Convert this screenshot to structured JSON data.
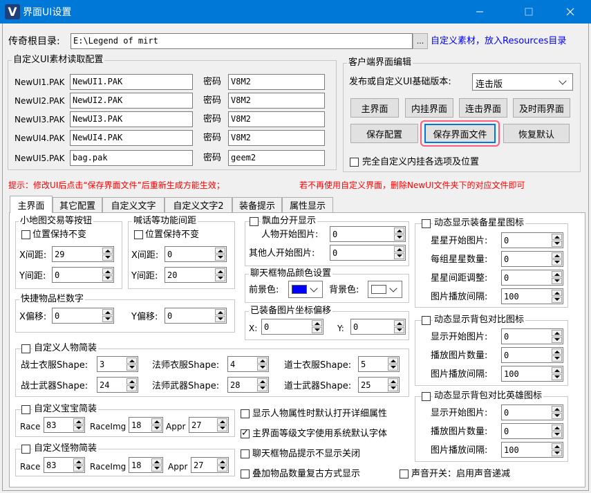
{
  "window": {
    "title": "界面UI设置",
    "app_icon_letter": "V"
  },
  "root": {
    "label": "传奇根目录:",
    "path": "E:\\Legend of mirt",
    "browse": "...",
    "hint": "自定义素材，放入Resources目录"
  },
  "pak_group": {
    "title": "自定义UI素材读取配置",
    "password_label": "密码",
    "rows": [
      {
        "label": "NewUI1.PAK",
        "file": "NewUI1.PAK",
        "password": "V8M2"
      },
      {
        "label": "NewUI2.PAK",
        "file": "NewUI2.PAK",
        "password": "V8M2"
      },
      {
        "label": "NewUI3.PAK",
        "file": "NewUI3.PAK",
        "password": "V8M2"
      },
      {
        "label": "NewUI4.PAK",
        "file": "NewUI4.PAK",
        "password": "V8M2"
      },
      {
        "label": "NewUI5.PAK",
        "file": "bag.pak",
        "password": "geem2"
      }
    ]
  },
  "client_group": {
    "title": "客户端界面编辑",
    "version_label": "发布或自定义UI基础版本:",
    "version_value": "连击版",
    "buttons_row1": [
      "主界面",
      "内挂界面",
      "连击界面",
      "及时雨界面"
    ],
    "save_config": "保存配置",
    "save_ui": "保存界面文件",
    "restore": "恢复默认",
    "full_custom": "完全自定义内挂各选项及位置"
  },
  "tip": {
    "left": "提示：修改UI后点击“保存界面文件”后重新生成方能生效；",
    "right": "若不再使用自定义界面，删除NewUI文件夹下的对应文件即可"
  },
  "tabs": [
    "主界面",
    "其它配置",
    "自定义文字",
    "自定义文字2",
    "装备提示",
    "属性显示"
  ],
  "minimap": {
    "title": "小地图交易等按钮",
    "keep": "位置保持不变",
    "x_label": "X间距:",
    "x": "29",
    "y_label": "Y间距:",
    "y": "0"
  },
  "shout": {
    "title": "喊话等功能间距",
    "keep": "位置保持不变",
    "x_label": "X间距:",
    "x": "0",
    "y_label": "Y间距:",
    "y": "20"
  },
  "quick": {
    "title": "快捷物品栏数字",
    "x_label": "X偏移:",
    "x": "0",
    "y_label": "Y偏移:",
    "y": "0"
  },
  "blood": {
    "title": "飘血分开显示",
    "self_label": "人物开始图片:",
    "self": "0",
    "other_label": "其他人开始图片:",
    "other": "0"
  },
  "chat_color": {
    "title": "聊天框物品颜色设置",
    "fg_label": "前景色:",
    "fg_color": "#0000ff",
    "bg_label": "背景色:",
    "bg_color": "#ffffff"
  },
  "equip_offset": {
    "title": "已装备图片坐标偏移",
    "x_label": "X:",
    "x": "0",
    "y_label": "Y:",
    "y": "0"
  },
  "star": {
    "title": "动态显示装备星星图标",
    "rows": [
      {
        "label": "星星开始图片:",
        "value": "0"
      },
      {
        "label": "每组星星数量:",
        "value": "0"
      },
      {
        "label": "星星间距调整:",
        "value": "0"
      },
      {
        "label": "图片播放间隔:",
        "value": "100"
      }
    ]
  },
  "bag_cmp": {
    "title": "动态显示背包对比图标",
    "rows": [
      {
        "label": "显示开始图片:",
        "value": "0"
      },
      {
        "label": "播放图片数量:",
        "value": "0"
      },
      {
        "label": "图片播放间隔:",
        "value": "100"
      }
    ]
  },
  "hero_cmp": {
    "title": "动态显示背包对比英雄图标",
    "rows": [
      {
        "label": "显示开始图片:",
        "value": "0"
      },
      {
        "label": "播放图片数量:",
        "value": "0"
      },
      {
        "label": "图片播放间隔:",
        "value": "100"
      }
    ]
  },
  "char": {
    "title": "自定义人物简装",
    "warrior_cloth": "战士衣服Shape:",
    "warrior_cloth_v": "3",
    "mage_cloth": "法师衣服Shape:",
    "mage_cloth_v": "4",
    "taoist_cloth": "道士衣服Shape:",
    "taoist_cloth_v": "5",
    "warrior_weapon": "战士武器Shape:",
    "warrior_weapon_v": "24",
    "mage_weapon": "法师武器Shape:",
    "mage_weapon_v": "28",
    "taoist_weapon": "道士武器Shape:",
    "taoist_weapon_v": "25"
  },
  "pet": {
    "title": "自定义宝宝简装",
    "race": "Race",
    "race_v": "83",
    "raceimg": "RaceImg",
    "raceimg_v": "18",
    "appr": "Appr",
    "appr_v": "27"
  },
  "monster": {
    "title": "自定义怪物简装",
    "race": "Race",
    "race_v": "83",
    "raceimg": "RaceImg",
    "raceimg_v": "18",
    "appr": "Appr",
    "appr_v": "27"
  },
  "options": [
    {
      "label": "显示人物属性时默认打开详细属性",
      "checked": false
    },
    {
      "label": "主界面等级文字使用系统默认字体",
      "checked": true
    },
    {
      "label": "聊天框物品提示不显示关闭",
      "checked": false
    },
    {
      "label": "叠加物品数量复古方式显示",
      "checked": false
    }
  ],
  "sound": {
    "label": "声音开关：启用声音递减",
    "checked": false
  }
}
